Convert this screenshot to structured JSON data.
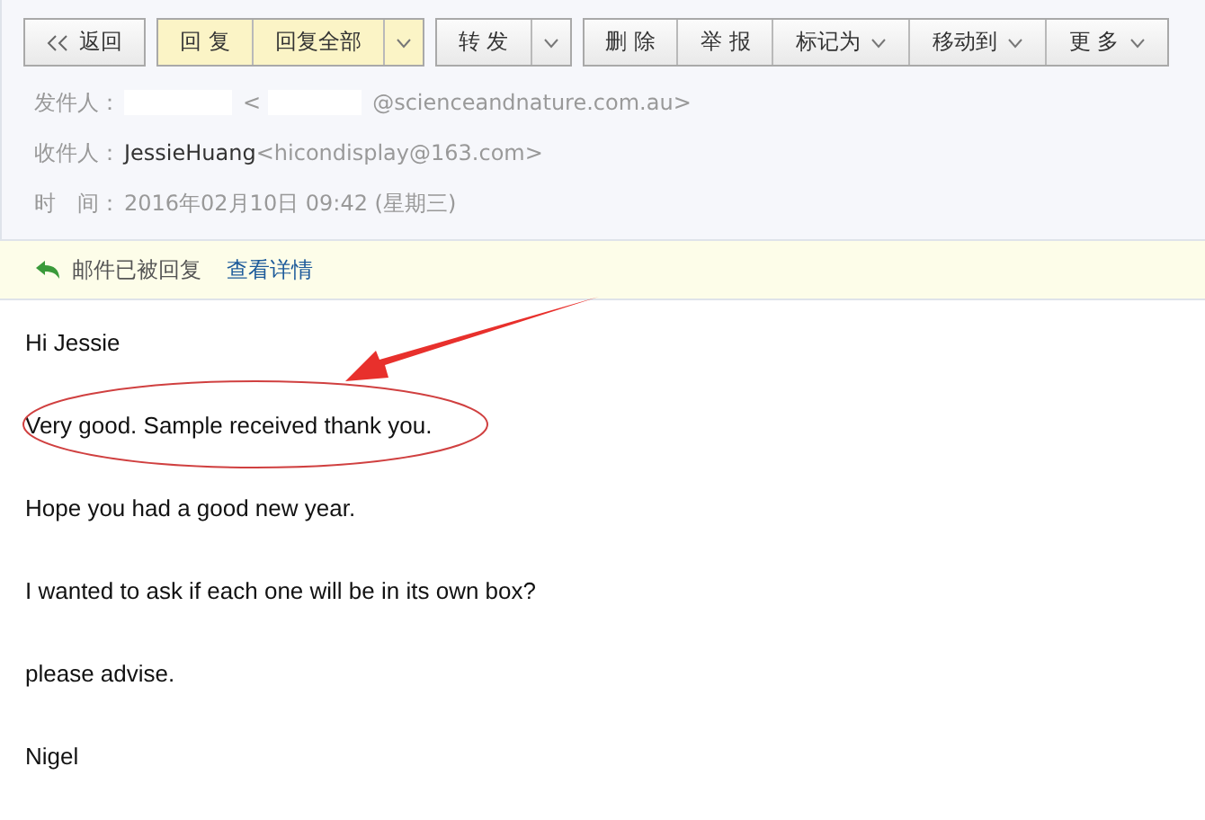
{
  "toolbar": [
    {
      "highlighted": false,
      "buttons": [
        {
          "kind": "back",
          "label": "返回"
        }
      ]
    },
    {
      "highlighted": true,
      "buttons": [
        {
          "kind": "button",
          "label": "回 复"
        },
        {
          "kind": "button",
          "label": "回复全部"
        },
        {
          "kind": "caret"
        }
      ]
    },
    {
      "highlighted": false,
      "buttons": [
        {
          "kind": "button",
          "label": "转 发"
        },
        {
          "kind": "caret"
        }
      ]
    },
    {
      "highlighted": false,
      "buttons": [
        {
          "kind": "button",
          "label": "删 除"
        },
        {
          "kind": "button",
          "label": "举 报"
        },
        {
          "kind": "menu",
          "label": "标记为"
        },
        {
          "kind": "menu",
          "label": "移动到"
        },
        {
          "kind": "menu",
          "label": "更 多"
        }
      ]
    }
  ],
  "header": [
    {
      "kind": "sender",
      "label": "发件人：",
      "parts": [
        "<",
        "@scienceandnature.com.au>"
      ]
    },
    {
      "kind": "recipient",
      "label": "收件人：",
      "name": "JessieHuang",
      "address": "<hicondisplay@163.com>"
    },
    {
      "kind": "time",
      "label": "时　间：",
      "value": "2016年02月10日 09:42 (星期三)"
    }
  ],
  "notice": {
    "text": "邮件已被回复",
    "link": "查看详情"
  },
  "body": [
    {
      "text": "Hi Jessie",
      "circled": false
    },
    {
      "text": "Very good. Sample received thank you.",
      "circled": true
    },
    {
      "text": "Hope you had a good new year.",
      "circled": false
    },
    {
      "text": "I wanted to ask if each one will be in its own box?",
      "circled": false
    },
    {
      "text": "please advise.",
      "circled": false
    },
    {
      "text": "Nigel",
      "circled": false
    }
  ]
}
